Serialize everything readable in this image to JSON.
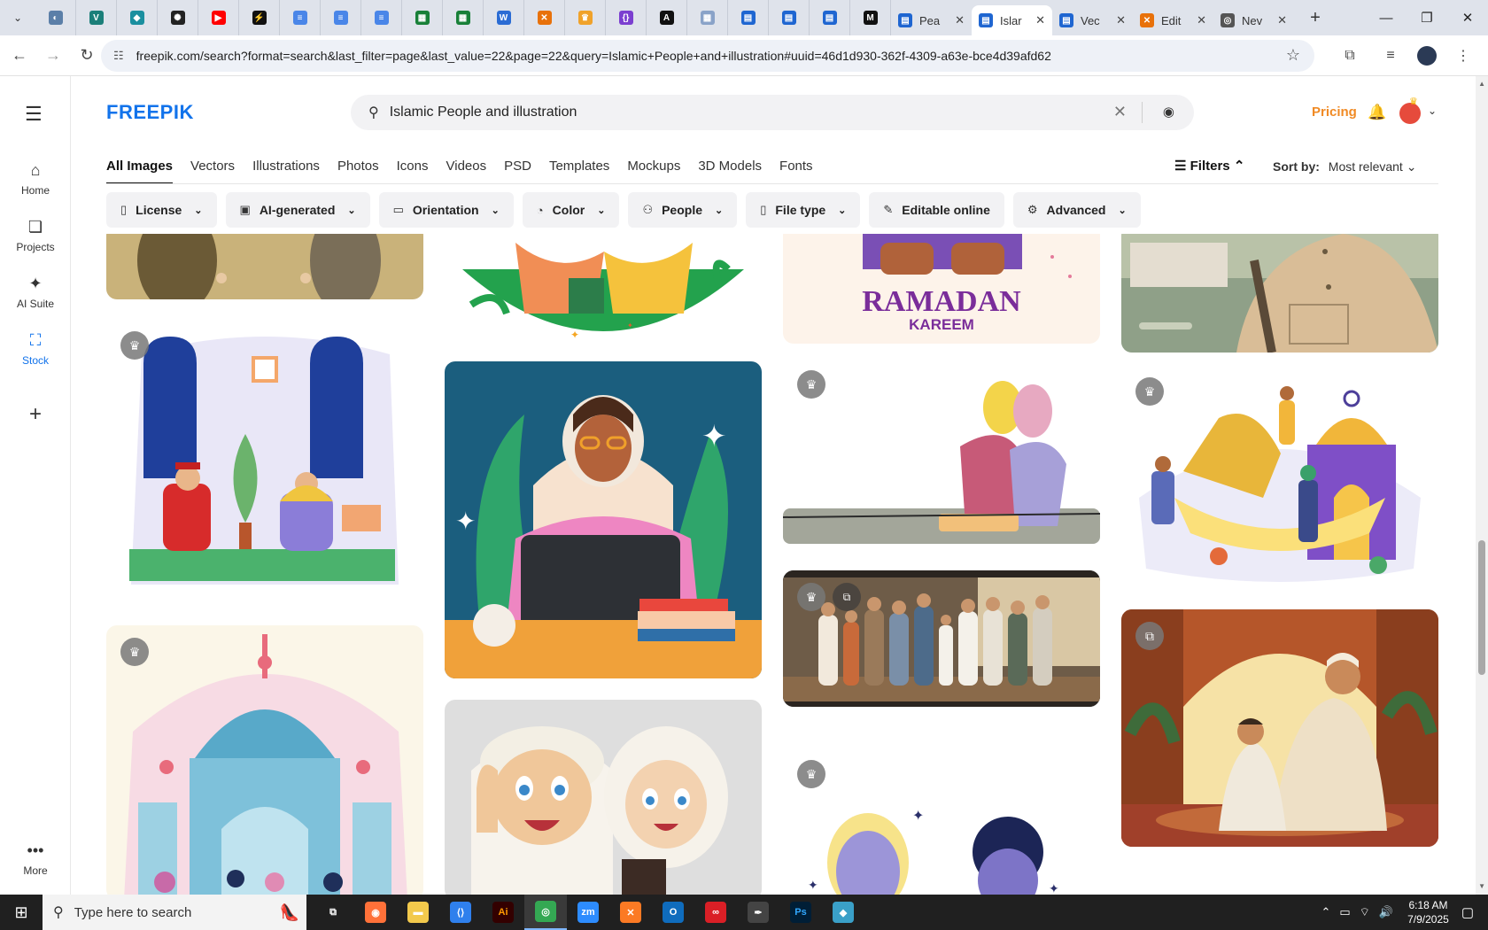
{
  "browser": {
    "tab_menu_icon": "chevron-down-icon",
    "pinned_tabs": [
      {
        "icon": "globe-icon",
        "color": "#5b7fa8"
      },
      {
        "icon": "v-icon",
        "color": "#1b7f79"
      },
      {
        "icon": "diamond-icon",
        "color": "#1a8f9f"
      },
      {
        "icon": "openai-icon",
        "color": "#222222"
      },
      {
        "icon": "youtube-icon",
        "color": "#ff0000"
      },
      {
        "icon": "bolt-icon",
        "color": "#111111"
      },
      {
        "icon": "docs-icon",
        "color": "#4a86e8"
      },
      {
        "icon": "docs-icon",
        "color": "#4a86e8"
      },
      {
        "icon": "docs-icon",
        "color": "#4a86e8"
      },
      {
        "icon": "sheets-icon",
        "color": "#188038"
      },
      {
        "icon": "sheets-icon",
        "color": "#188038"
      },
      {
        "icon": "word-icon",
        "color": "#2b6cd4"
      },
      {
        "icon": "x-box-icon",
        "color": "#e8710a"
      },
      {
        "icon": "crown-icon",
        "color": "#f0a22a"
      },
      {
        "icon": "braces-icon",
        "color": "#7b3fd0"
      },
      {
        "icon": "a-icon",
        "color": "#111111"
      },
      {
        "icon": "grid-icon",
        "color": "#8aa3c8"
      },
      {
        "icon": "forms-icon",
        "color": "#1f66d1"
      },
      {
        "icon": "forms-icon",
        "color": "#1f66d1"
      },
      {
        "icon": "forms-icon",
        "color": "#1f66d1"
      },
      {
        "icon": "m-icon",
        "color": "#111111"
      }
    ],
    "named_tabs": [
      {
        "label": "Pea",
        "icon": "forms-icon",
        "color": "#1f66d1",
        "active": false
      },
      {
        "label": "Islar",
        "icon": "forms-icon",
        "color": "#1f66d1",
        "active": true
      },
      {
        "label": "Vec",
        "icon": "forms-icon",
        "color": "#1f66d1",
        "active": false
      },
      {
        "label": "Edit",
        "icon": "x-box-icon",
        "color": "#e8710a",
        "active": false
      },
      {
        "label": "Nev",
        "icon": "chrome-icon",
        "color": "#555555",
        "active": false
      }
    ],
    "url": "freepik.com/search?format=search&last_filter=page&last_value=22&page=22&query=Islamic+People+and+illustration#uuid=46d1d930-362f-4309-a63e-bce4d39afd62"
  },
  "rail": {
    "items": [
      {
        "label": "Home",
        "icon": "home-icon"
      },
      {
        "label": "Projects",
        "icon": "projects-icon"
      },
      {
        "label": "AI Suite",
        "icon": "sparkle-icon"
      },
      {
        "label": "Stock",
        "icon": "stock-icon"
      }
    ],
    "more_label": "More"
  },
  "header": {
    "logo": "FREEPIK",
    "search_value": "Islamic People and illustration",
    "pricing": "Pricing"
  },
  "categories": [
    "All Images",
    "Vectors",
    "Illustrations",
    "Photos",
    "Icons",
    "Videos",
    "PSD",
    "Templates",
    "Mockups",
    "3D Models",
    "Fonts"
  ],
  "active_category": "All Images",
  "filters_label": "Filters",
  "sort": {
    "label": "Sort by:",
    "value": "Most relevant"
  },
  "chips": [
    {
      "label": "License",
      "icon": "license-icon"
    },
    {
      "label": "AI-generated",
      "icon": "ai-icon"
    },
    {
      "label": "Orientation",
      "icon": "orientation-icon"
    },
    {
      "label": "Color",
      "icon": "palette-icon"
    },
    {
      "label": "People",
      "icon": "people-icon"
    },
    {
      "label": "File type",
      "icon": "file-icon"
    },
    {
      "label": "Editable online",
      "icon": "pencil-icon"
    },
    {
      "label": "Advanced",
      "icon": "gear-icon"
    }
  ],
  "cards": {
    "ramadan_text": "RAMADAN",
    "kareem_text": "KAREEM"
  },
  "taskbar": {
    "search_placeholder": "Type here to search",
    "time": "6:18 AM",
    "date": "7/9/2025",
    "apps": [
      {
        "icon": "task-view-icon",
        "color": "#202020"
      },
      {
        "icon": "firefox-icon",
        "color": "#ff7139"
      },
      {
        "icon": "folder-icon",
        "color": "#f2c94c"
      },
      {
        "icon": "vscode-icon",
        "color": "#2f80ed"
      },
      {
        "icon": "illustrator-icon",
        "color": "#330000"
      },
      {
        "icon": "chrome-icon",
        "color": "#34a853"
      },
      {
        "icon": "zoom-icon",
        "color": "#2d8cff"
      },
      {
        "icon": "xampp-icon",
        "color": "#fb7a24"
      },
      {
        "icon": "outlook-icon",
        "color": "#0f6cbd"
      },
      {
        "icon": "creative-cloud-icon",
        "color": "#da1f26"
      },
      {
        "icon": "pen-tool-icon",
        "color": "#444444"
      },
      {
        "icon": "photoshop-icon",
        "color": "#001e36"
      },
      {
        "icon": "gem-icon",
        "color": "#3aa0c8"
      }
    ]
  }
}
